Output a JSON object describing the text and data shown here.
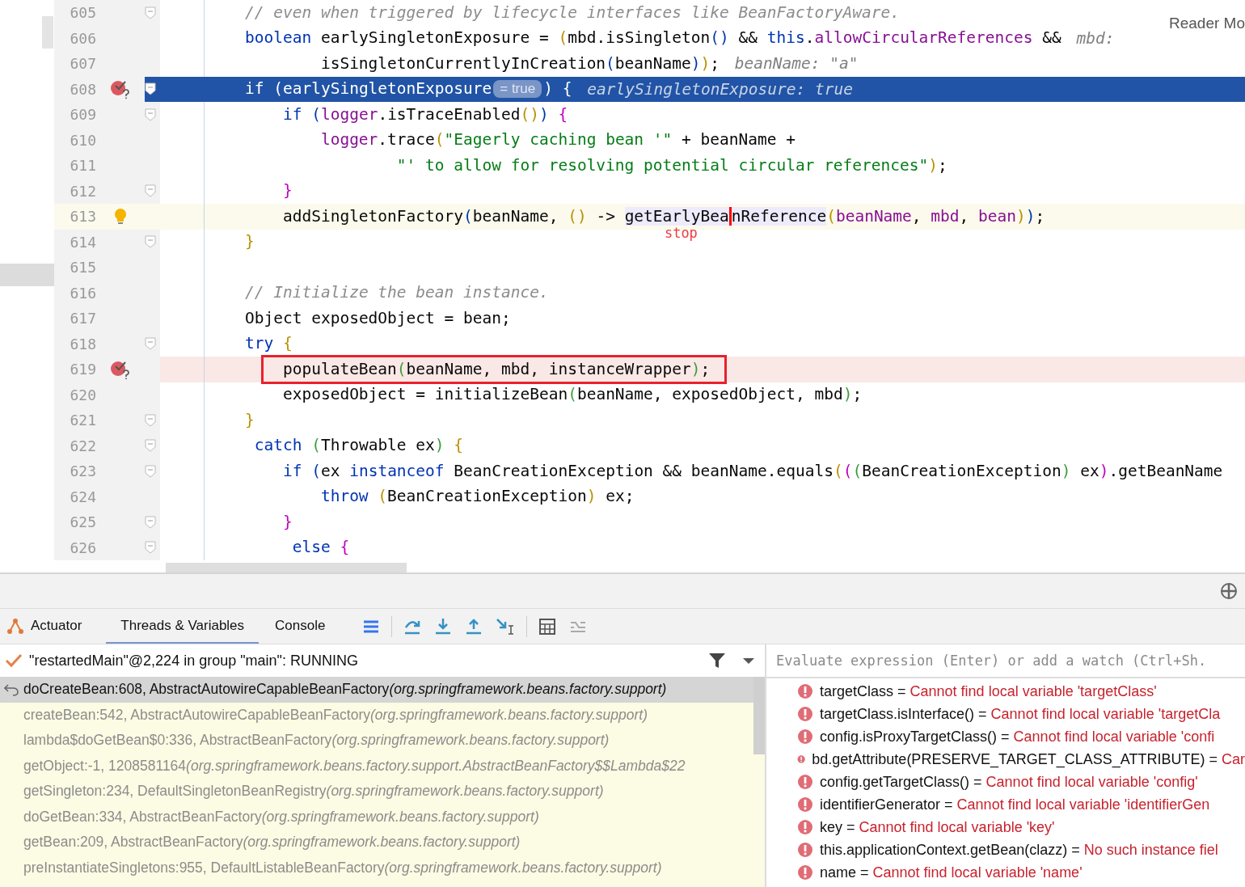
{
  "editor": {
    "reader_mode": "Reader Mo",
    "lines": [
      {
        "no": "605",
        "current": false,
        "caret": false,
        "breakpoint": false,
        "fold": true,
        "tokens": [
          {
            "t": "// even when triggered by lifecycle interfaces like BeanFactoryAware.",
            "kind": "comment"
          }
        ]
      },
      {
        "no": "606",
        "current": false,
        "caret": false,
        "breakpoint": false,
        "fold": false,
        "tokens": [
          {
            "t": "boolean",
            "kind": "keyword"
          },
          {
            "t": " earlySingletonExposure = ",
            "kind": "plain"
          },
          {
            "t": "(",
            "kind": "paren1"
          },
          {
            "t": "mbd.isSingleton",
            "kind": "plain"
          },
          {
            "t": "()",
            "kind": "paren4"
          },
          {
            "t": " && ",
            "kind": "plain"
          },
          {
            "t": "this",
            "kind": "keyword"
          },
          {
            "t": ".",
            "kind": "plain"
          },
          {
            "t": "allowCircularReferences",
            "kind": "field"
          },
          {
            "t": " &&",
            "kind": "plain"
          },
          {
            "t": "mbd:",
            "kind": "hint"
          }
        ]
      },
      {
        "no": "607",
        "current": false,
        "caret": false,
        "breakpoint": false,
        "fold": false,
        "tokens": [
          {
            "t": "        isSingletonCurrentlyInCreation",
            "kind": "plain"
          },
          {
            "t": "(",
            "kind": "paren4"
          },
          {
            "t": "beanName",
            "kind": "plain"
          },
          {
            "t": ")",
            "kind": "paren4"
          },
          {
            "t": ")",
            "kind": "paren1"
          },
          {
            "t": ";",
            "kind": "plain"
          },
          {
            "t": "beanName: \"a\"",
            "kind": "hint"
          }
        ]
      },
      {
        "no": "608",
        "current": true,
        "caret": false,
        "breakpoint": true,
        "fold": true,
        "tokens": [
          {
            "t": "if",
            "kind": "keyword"
          },
          {
            "t": " (earlySingletonExposure",
            "kind": "plain"
          },
          {
            "t": "= true",
            "kind": "pill"
          },
          {
            "t": ") {",
            "kind": "plain"
          },
          {
            "t": "earlySingletonExposure: true",
            "kind": "hint"
          }
        ]
      },
      {
        "no": "609",
        "current": false,
        "caret": false,
        "breakpoint": false,
        "fold": true,
        "tokens": [
          {
            "t": "    if ",
            "kind": "keyword"
          },
          {
            "t": "(",
            "kind": "paren4"
          },
          {
            "t": "logger",
            "kind": "field"
          },
          {
            "t": ".isTraceEnabled",
            "kind": "plain"
          },
          {
            "t": "()",
            "kind": "paren1"
          },
          {
            "t": ") ",
            "kind": "paren4"
          },
          {
            "t": "{",
            "kind": "paren2"
          }
        ]
      },
      {
        "no": "610",
        "current": false,
        "caret": false,
        "breakpoint": false,
        "fold": false,
        "tokens": [
          {
            "t": "        logger",
            "kind": "field"
          },
          {
            "t": ".trace",
            "kind": "plain"
          },
          {
            "t": "(",
            "kind": "paren1"
          },
          {
            "t": "\"Eagerly caching bean '\"",
            "kind": "string"
          },
          {
            "t": " + beanName +",
            "kind": "plain"
          }
        ]
      },
      {
        "no": "611",
        "current": false,
        "caret": false,
        "breakpoint": false,
        "fold": false,
        "tokens": [
          {
            "t": "                \"' to allow for resolving potential circular references\"",
            "kind": "string"
          },
          {
            "t": ")",
            "kind": "paren1"
          },
          {
            "t": ";",
            "kind": "plain"
          }
        ]
      },
      {
        "no": "612",
        "current": false,
        "caret": false,
        "breakpoint": false,
        "fold": true,
        "tokens": [
          {
            "t": "    }",
            "kind": "paren2"
          }
        ]
      },
      {
        "no": "613",
        "current": false,
        "caret": true,
        "breakpoint": false,
        "fold": false,
        "note": "stop",
        "tokens": [
          {
            "t": "    addSingletonFactory",
            "kind": "plain"
          },
          {
            "t": "(",
            "kind": "paren4"
          },
          {
            "t": "beanName, ",
            "kind": "plain"
          },
          {
            "t": "()",
            "kind": "paren1"
          },
          {
            "t": " -> ",
            "kind": "plain"
          },
          {
            "t": "getEarlyBea",
            "kind": "ref"
          },
          {
            "t": "nReference",
            "kind": "refcursor"
          },
          {
            "t": "(",
            "kind": "paren1"
          },
          {
            "t": "beanName",
            "kind": "field"
          },
          {
            "t": ", ",
            "kind": "plain"
          },
          {
            "t": "mbd",
            "kind": "field"
          },
          {
            "t": ", ",
            "kind": "plain"
          },
          {
            "t": "bean",
            "kind": "field"
          },
          {
            "t": ")",
            "kind": "paren1"
          },
          {
            "t": ")",
            "kind": "paren4"
          },
          {
            "t": ";",
            "kind": "plain"
          }
        ]
      },
      {
        "no": "614",
        "current": false,
        "caret": false,
        "breakpoint": false,
        "fold": true,
        "tokens": [
          {
            "t": "}",
            "kind": "paren1"
          }
        ]
      },
      {
        "no": "615",
        "current": false,
        "caret": false,
        "breakpoint": false,
        "fold": false
      },
      {
        "no": "616",
        "current": false,
        "caret": false,
        "breakpoint": false,
        "fold": false,
        "tokens": [
          {
            "t": "// Initialize the bean instance.",
            "kind": "comment"
          }
        ]
      },
      {
        "no": "617",
        "current": false,
        "caret": false,
        "breakpoint": false,
        "fold": false,
        "tokens": [
          {
            "t": "Object exposedObject = bean;",
            "kind": "plain"
          }
        ]
      },
      {
        "no": "618",
        "current": false,
        "caret": false,
        "breakpoint": false,
        "fold": true,
        "tokens": [
          {
            "t": "try ",
            "kind": "keyword"
          },
          {
            "t": "{",
            "kind": "paren1"
          }
        ]
      },
      {
        "no": "619",
        "current": false,
        "caret": false,
        "breakpoint": true,
        "fold": false,
        "boxed": true,
        "tokens": [
          {
            "t": "    populateBean",
            "kind": "plain"
          },
          {
            "t": "(",
            "kind": "paren3"
          },
          {
            "t": "beanName, mbd, instanceWrapper",
            "kind": "plain"
          },
          {
            "t": ")",
            "kind": "paren3"
          },
          {
            "t": ";",
            "kind": "plain"
          }
        ]
      },
      {
        "no": "620",
        "current": false,
        "caret": false,
        "breakpoint": false,
        "fold": false,
        "tokens": [
          {
            "t": "    exposedObject = initializeBean",
            "kind": "plain"
          },
          {
            "t": "(",
            "kind": "paren3"
          },
          {
            "t": "beanName, exposedObject, mbd",
            "kind": "plain"
          },
          {
            "t": ")",
            "kind": "paren3"
          },
          {
            "t": ";",
            "kind": "plain"
          }
        ]
      },
      {
        "no": "621",
        "current": false,
        "caret": false,
        "breakpoint": false,
        "fold": true,
        "tokens": [
          {
            "t": "}",
            "kind": "paren1"
          }
        ]
      },
      {
        "no": "622",
        "current": false,
        "caret": false,
        "breakpoint": false,
        "fold": true,
        "tokens": [
          {
            "t": " catch ",
            "kind": "keyword"
          },
          {
            "t": "(",
            "kind": "paren3"
          },
          {
            "t": "Throwable ex",
            "kind": "plain"
          },
          {
            "t": ") ",
            "kind": "paren3"
          },
          {
            "t": "{",
            "kind": "paren1"
          }
        ]
      },
      {
        "no": "623",
        "current": false,
        "caret": false,
        "breakpoint": false,
        "fold": true,
        "tokens": [
          {
            "t": "    if ",
            "kind": "keyword"
          },
          {
            "t": "(",
            "kind": "paren4"
          },
          {
            "t": "ex ",
            "kind": "plain"
          },
          {
            "t": "instanceof",
            "kind": "keyword"
          },
          {
            "t": " BeanCreationException && beanName.equals",
            "kind": "plain"
          },
          {
            "t": "(",
            "kind": "paren1"
          },
          {
            "t": "(",
            "kind": "paren2"
          },
          {
            "t": "(",
            "kind": "paren3"
          },
          {
            "t": "BeanCreationException",
            "kind": "plain"
          },
          {
            "t": ")",
            "kind": "paren3"
          },
          {
            "t": " ex",
            "kind": "plain"
          },
          {
            "t": ")",
            "kind": "paren2"
          },
          {
            "t": ".getBeanName",
            "kind": "plain"
          }
        ]
      },
      {
        "no": "624",
        "current": false,
        "caret": false,
        "breakpoint": false,
        "fold": false,
        "tokens": [
          {
            "t": "        throw ",
            "kind": "keyword"
          },
          {
            "t": "(",
            "kind": "paren1"
          },
          {
            "t": "BeanCreationException",
            "kind": "plain"
          },
          {
            "t": ")",
            "kind": "paren1"
          },
          {
            "t": " ex;",
            "kind": "plain"
          }
        ]
      },
      {
        "no": "625",
        "current": false,
        "caret": false,
        "breakpoint": false,
        "fold": true,
        "tokens": [
          {
            "t": "    }",
            "kind": "paren2"
          }
        ]
      },
      {
        "no": "626",
        "current": false,
        "caret": false,
        "breakpoint": false,
        "fold": true,
        "tokens": [
          {
            "t": "     else ",
            "kind": "keyword"
          },
          {
            "t": "{",
            "kind": "paren2"
          }
        ]
      }
    ]
  },
  "debugger": {
    "tabs": [
      {
        "label": "Actuator",
        "selected": false
      },
      {
        "label": "Threads & Variables",
        "selected": true
      },
      {
        "label": "Console",
        "selected": false
      }
    ],
    "thread": "\"restartedMain\"@2,224 in group \"main\": RUNNING",
    "frames": [
      {
        "method": "doCreateBean:608, AbstractAutowireCapableBeanFactory",
        "pkg": "(org.springframework.beans.factory.support)",
        "selected": true
      },
      {
        "method": "createBean:542, AbstractAutowireCapableBeanFactory",
        "pkg": "(org.springframework.beans.factory.support)",
        "selected": false
      },
      {
        "method": "lambda$doGetBean$0:336, AbstractBeanFactory",
        "pkg": "(org.springframework.beans.factory.support)",
        "selected": false
      },
      {
        "method": "getObject:-1, 1208581164",
        "pkg": "(org.springframework.beans.factory.support.AbstractBeanFactory$$Lambda$22",
        "selected": false
      },
      {
        "method": "getSingleton:234, DefaultSingletonBeanRegistry",
        "pkg": "(org.springframework.beans.factory.support)",
        "selected": false
      },
      {
        "method": "doGetBean:334, AbstractBeanFactory",
        "pkg": "(org.springframework.beans.factory.support)",
        "selected": false
      },
      {
        "method": "getBean:209, AbstractBeanFactory",
        "pkg": "(org.springframework.beans.factory.support)",
        "selected": false
      },
      {
        "method": "preInstantiateSingletons:955, DefaultListableBeanFactory",
        "pkg": "(org.springframework.beans.factory.support)",
        "selected": false
      }
    ],
    "evaluate": {
      "placeholder": "Evaluate expression (Enter) or add a watch (Ctrl+Sh."
    },
    "watches": [
      {
        "expr": "targetClass =",
        "value": "Cannot find local variable 'targetClass'"
      },
      {
        "expr": "targetClass.isInterface() =",
        "value": "Cannot find local variable 'targetCla"
      },
      {
        "expr": "config.isProxyTargetClass() =",
        "value": "Cannot find local variable 'confi"
      },
      {
        "expr": "bd.getAttribute(PRESERVE_TARGET_CLASS_ATTRIBUTE) =",
        "value": "Car"
      },
      {
        "expr": "config.getTargetClass() =",
        "value": "Cannot find local variable 'config'"
      },
      {
        "expr": "identifierGenerator =",
        "value": "Cannot find local variable 'identifierGen"
      },
      {
        "expr": "key =",
        "value": "Cannot find local variable 'key'"
      },
      {
        "expr": "this.applicationContext.getBean(clazz) =",
        "value": "No such instance fiel"
      },
      {
        "expr": "name =",
        "value": "Cannot find local variable 'name'"
      }
    ]
  }
}
